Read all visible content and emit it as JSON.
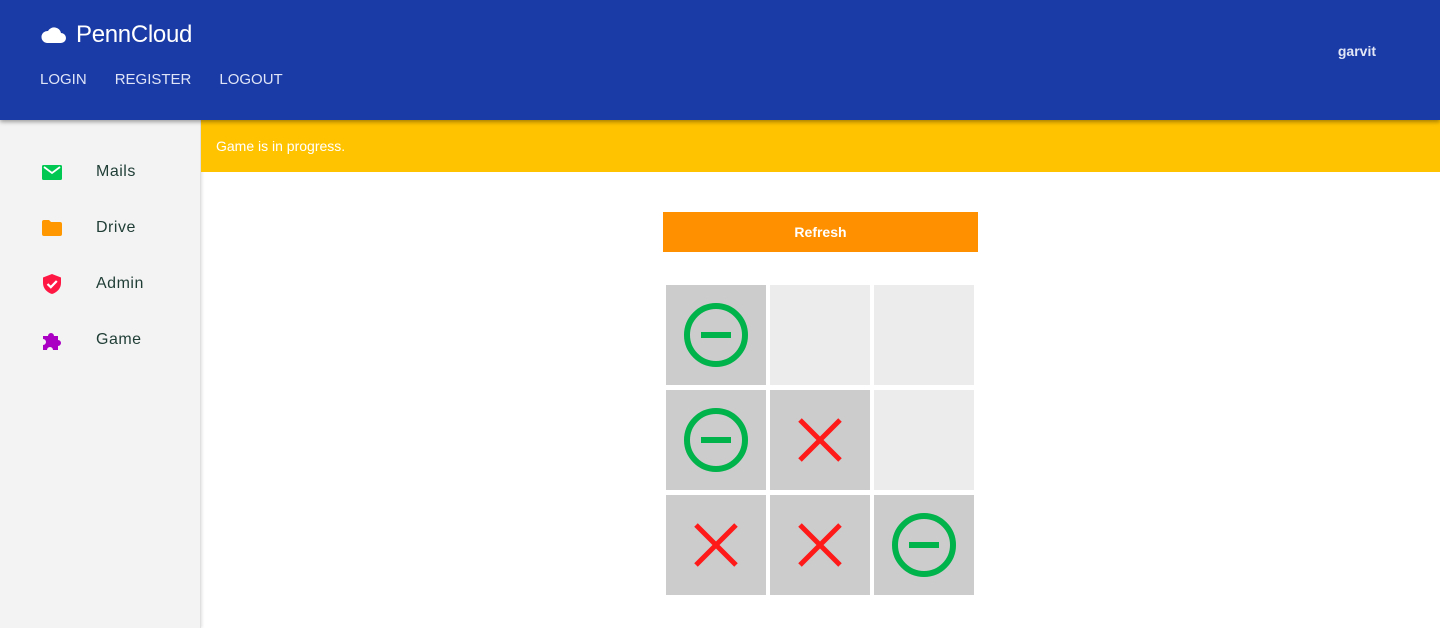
{
  "header": {
    "brand": "PennCloud",
    "brand_icon": "cloud-icon",
    "nav": [
      {
        "label": "LOGIN"
      },
      {
        "label": "REGISTER"
      },
      {
        "label": "LOGOUT"
      }
    ],
    "username": "garvit",
    "background_color": "#1a3aa6"
  },
  "sidebar": {
    "items": [
      {
        "label": "Mails",
        "icon": "mail-icon",
        "color": "#00c853"
      },
      {
        "label": "Drive",
        "icon": "folder-icon",
        "color": "#ff9800"
      },
      {
        "label": "Admin",
        "icon": "shield-check-icon",
        "color": "#ff1744"
      },
      {
        "label": "Game",
        "icon": "puzzle-icon",
        "color": "#aa00c4"
      }
    ]
  },
  "status": {
    "message": "Game is in progress.",
    "color": "#ffc300"
  },
  "game": {
    "refresh_label": "Refresh",
    "refresh_color": "#ff9100",
    "board": [
      [
        "O",
        "",
        ""
      ],
      [
        "O",
        "X",
        ""
      ],
      [
        "X",
        "X",
        "O"
      ]
    ],
    "o_mark_color": "#00b34a",
    "x_mark_color": "#ff1a1a"
  }
}
